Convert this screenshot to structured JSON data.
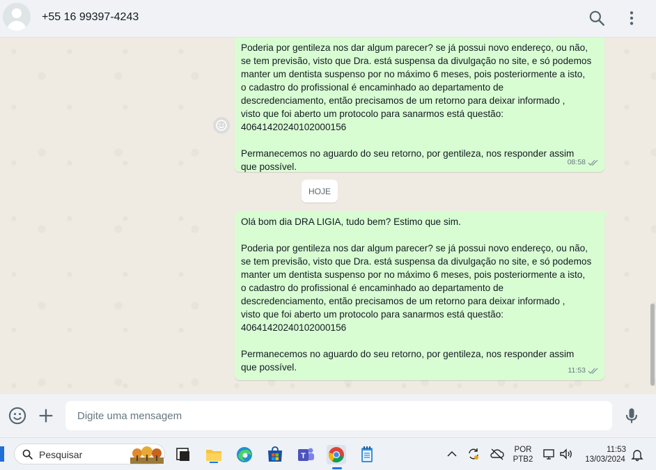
{
  "header": {
    "contact": "+55 16 99397-4243",
    "icons": [
      "search-icon",
      "menu-dots-icon"
    ]
  },
  "messages": [
    {
      "lines": [
        "Poderia por gentileza nos dar algum parecer? se já possui novo endereço, ou não,",
        "se tem previsão, visto que Dra. está suspensa da divulgação no site, e só podemos",
        "manter um dentista suspenso por no máximo 6 meses, pois posteriormente a isto,",
        "o cadastro do profissional é encaminhado ao departamento de",
        "descredenciamento, então precisamos de um retorno para deixar informado ,",
        "visto que foi aberto um protocolo para sanarmos está questão:",
        "40641420240102000156",
        "",
        "Permanecemos no aguardo do seu retorno, por gentileza, nos responder assim",
        "que possível."
      ],
      "time": "08:58"
    },
    {
      "lines": [
        "Olá bom dia DRA LIGIA, tudo bem? Estimo que sim.",
        "",
        "Poderia por gentileza nos dar algum parecer? se já possui novo endereço, ou não,",
        "se tem previsão, visto que Dra. está suspensa da divulgação no site, e só podemos",
        "manter um dentista suspenso por no máximo 6 meses, pois posteriormente a isto,",
        "o cadastro do profissional é encaminhado ao departamento de",
        "descredenciamento, então precisamos de um retorno para deixar informado ,",
        "visto que foi aberto um protocolo para sanarmos está questão:",
        "40641420240102000156",
        "",
        "Permanecemos no aguardo do seu retorno, por gentileza, nos responder assim",
        "que possível."
      ],
      "time": "11:53"
    }
  ],
  "date_separator": "HOJE",
  "composer": {
    "placeholder": "Digite uma mensagem",
    "icons": [
      "emoji-icon",
      "plus-icon",
      "microphone-icon"
    ]
  },
  "taskbar": {
    "search_label": "Pesquisar",
    "language_top": "POR",
    "language_bottom": "PTB2",
    "time": "11:53",
    "date": "13/03/2024"
  },
  "colors": {
    "outgoing_bubble": "#d9fdd3",
    "chat_background": "#efeae2",
    "header_background": "#f0f2f5",
    "read_ticks": "#8696a0"
  }
}
